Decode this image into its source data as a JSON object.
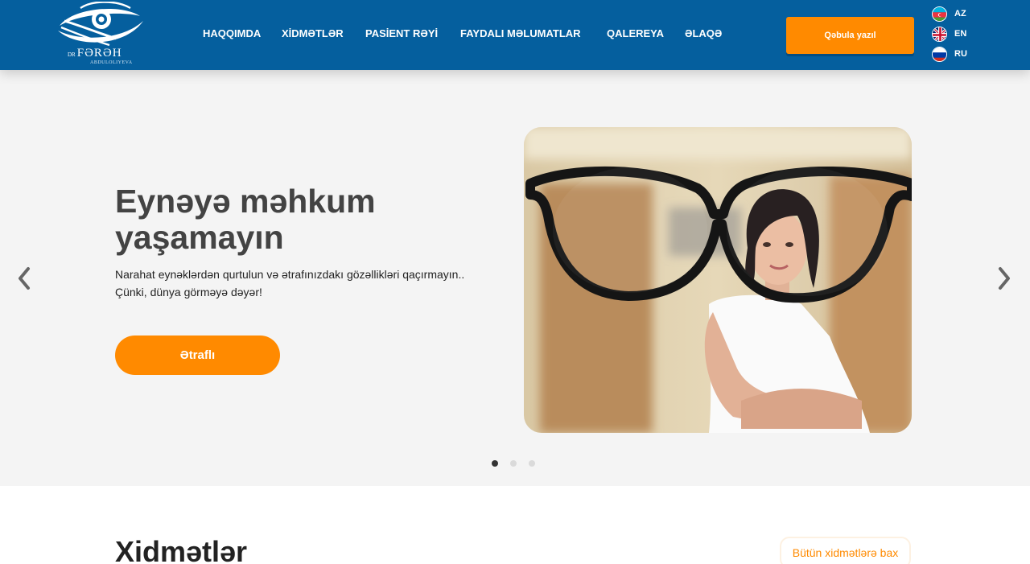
{
  "header": {
    "logo": {
      "prefix": "DR",
      "name": "FƏRƏH",
      "surname": "ABDULOLIYEVA"
    },
    "nav": [
      "HAQQIMDA",
      "XİDMƏTLƏR",
      "PASİENT RƏYİ",
      "FAYDALI MƏLUMATLAR",
      "QALEREYA",
      "ƏLAQƏ"
    ],
    "cta_label": "Qəbula yazıl",
    "languages": [
      "AZ",
      "EN",
      "RU"
    ]
  },
  "hero": {
    "title": "Eynəyə məhkum yaşamayın",
    "text": "Narahat eynəklərdən qurtulun və ətrafınızdakı gözəllikləri qaçırmayın.. Çünki, dünya görməyə dəyər!",
    "button_label": "Ətraflı",
    "image_alt": "doctor-with-glasses-photo",
    "slides_total": 3,
    "active_slide": 1
  },
  "services": {
    "title": "Xidmətlər",
    "all_label": "Bütün xidmətlərə bax"
  },
  "colors": {
    "header_bg": "#055f9e",
    "accent": "#ff8a00",
    "hero_bg": "#f4f4f4",
    "title_text": "#434343"
  },
  "icons": [
    "logo-eye-icon",
    "flag-az-icon",
    "flag-en-icon",
    "flag-ru-icon",
    "chevron-left-icon",
    "chevron-right-icon"
  ]
}
